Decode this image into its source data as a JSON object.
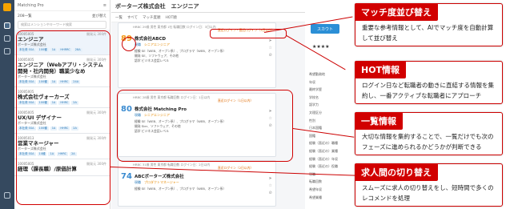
{
  "left": {
    "title": "Matching Pro",
    "sub_left": "208一覧",
    "sub_right": "並び替え",
    "search_placeholder": "検索はメンションやキーワード検索",
    "cards": [
      {
        "id": "10005005",
        "stat": "開発元 300件",
        "title": "エンジニア",
        "company": "ボーターズ株式会社",
        "tags": [
          "本社費 SSA",
          "100種",
          "1A",
          "HHRRC",
          "28A"
        ]
      },
      {
        "id": "10005005",
        "stat": "開発元 300件",
        "title": "エンジニア（Webアプリ・システム開発・社内開発）職業少なめ",
        "company": "ボーターズ株式会社",
        "tags": [
          "本社費 SSA",
          "100種",
          "1A",
          "HHRC",
          "24A"
        ]
      },
      {
        "id": "10005005",
        "stat": "",
        "title": "株式会社ヴォーカーズ",
        "company": "",
        "tags": [
          "本社費 SSA",
          "100種",
          "1A",
          "HHRC",
          "2A"
        ]
      },
      {
        "id": "10005005",
        "stat": "開発元 300件",
        "title": "UX/UI デザイナー",
        "company": "ボーターズ株式会社",
        "tags": [
          "本社費 SSA",
          "100種",
          "1A",
          "HHRC",
          "2A"
        ]
      },
      {
        "id": "10005013",
        "stat": "開発元 300件",
        "title": "営業マネージャー",
        "company": "ボーターズ株式会社",
        "tags": [
          "本社費 SSA",
          "10種",
          "1A",
          "HHRC",
          "2A"
        ]
      },
      {
        "id": "10005005",
        "stat": "開発元 300件",
        "title": "経理（課長職）/原価計算",
        "company": "",
        "tags": []
      }
    ]
  },
  "main": {
    "title": "ボーターズ株式会社　エンジニア",
    "sub": [
      "一覧",
      "すべて",
      "マッチ度順",
      "HOT順"
    ],
    "cands": [
      {
        "meta": "HRBC 29歳 男性 東京都 1社 転職回数 ログイン日：3日以内",
        "score": "89",
        "company": "株式会社ABCD",
        "pos": "現職",
        "pos_title": "シニアエンジニア",
        "l1": "経験 SE（WEB、オープン系）、プログラマ（WEB、オープン系）",
        "l2": "開発 SE、ソフトウェア、その他",
        "l3": "語学 ビジネス会話レベル",
        "alert": "直近ログイン・直近ログイン（3日以内）"
      },
      {
        "meta": "HRBC 28歳 男性 東京都 転職回数 ログイン日：1日以内",
        "score": "80",
        "company": "株式会社 Matching Pro",
        "pos": "現職",
        "pos_title": "シニアエンジニア",
        "l1": "経験 SE（WEB、オープン系）、プログラマ（WEB、オープン系）",
        "l2": "開発 Sier、ソフトウェア、その他",
        "l3": "語学 ビジネス会話レベル",
        "alert": "直近ログイン（1日以内）"
      },
      {
        "meta": "HRBC 31歳 男性 東京都 転職回数 ログイン日：2日以内",
        "score": "74",
        "company": "ABCボーターズ株式会社",
        "pos": "現職",
        "pos_title": "プロダクトマネージャー",
        "l1": "経験 SE（WEB、オープン系）、プログラマ（WEB、オープン系）",
        "l2": "",
        "l3": "",
        "alert": "直近ログイン（2日以内）"
      }
    ]
  },
  "right": {
    "scout": "スカウト",
    "stars": "★★★★",
    "list": [
      "希望勤務地",
      "年収",
      "最終学歴",
      "学校名",
      "語学力",
      "文理区分",
      "性別",
      "日本国籍",
      "国籍",
      "経験（直近の）職種",
      "経験（直近の）業種",
      "経験（直近の）年収",
      "経験（直近の）役職",
      "現職",
      "転職回数",
      "希望年収",
      "希望業種"
    ]
  },
  "boxes": [
    {
      "head": "マッチ度並び替え",
      "body": "重要な参考情報として、AIでマッチ度を自動計算して並び替え"
    },
    {
      "head": "HOT情報",
      "body": "ログイン日など転職者の動きに直結する情報を集約し、一番アクティブな転職者にアプローチ"
    },
    {
      "head": "一覧情報",
      "body": "大切な情報を集約することで、一覧だけでも次のフェーズに進められるかどうかが判断できる"
    },
    {
      "head": "求人間の切り替え",
      "body": "スムーズに求人の切り替えをし、短時間で多くのレコメンドを処理"
    }
  ]
}
